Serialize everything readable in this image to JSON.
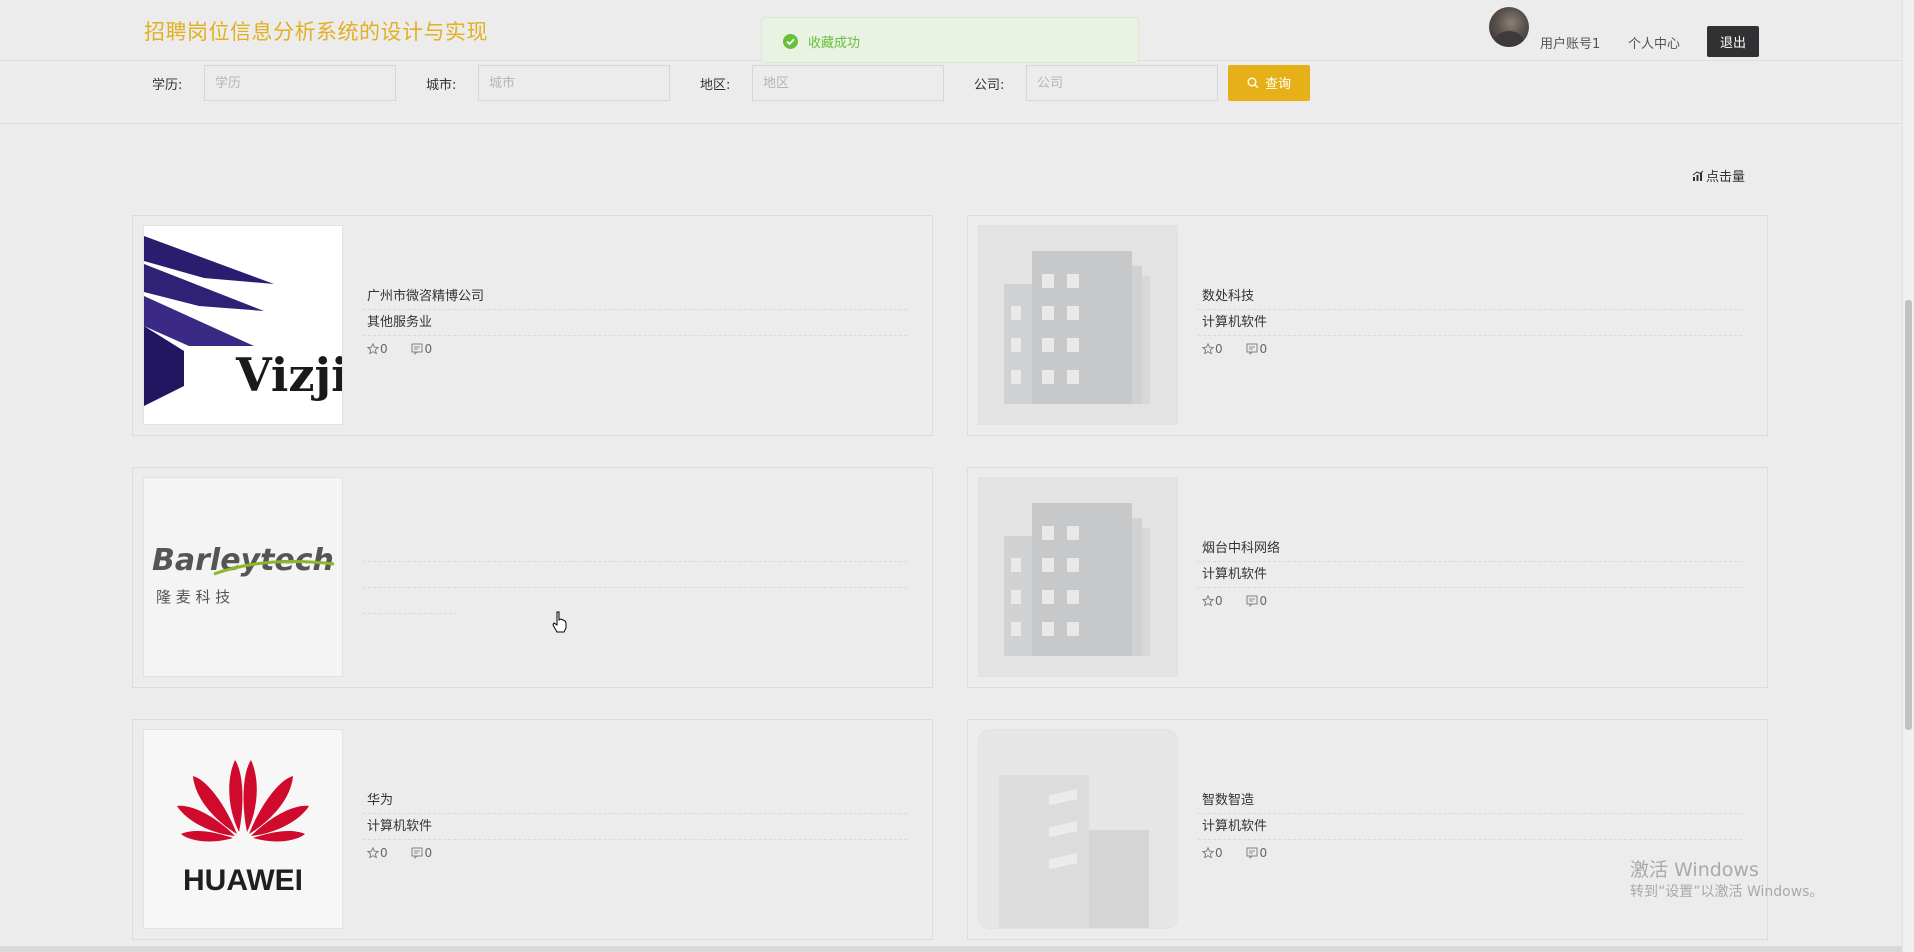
{
  "header": {
    "title": "招聘岗位信息分析系统的设计与实现",
    "user_account": "用户账号1",
    "personal_center": "个人中心",
    "logout": "退出"
  },
  "toast": {
    "message": "收藏成功",
    "icon": "check-circle-icon",
    "color": "#67c23a"
  },
  "filters": [
    {
      "label": "学历:",
      "placeholder": "学历",
      "value": ""
    },
    {
      "label": "城市:",
      "placeholder": "城市",
      "value": ""
    },
    {
      "label": "地区:",
      "placeholder": "地区",
      "value": ""
    },
    {
      "label": "公司:",
      "placeholder": "公司",
      "value": ""
    }
  ],
  "query_button": {
    "label": "查询",
    "color": "#e6b018"
  },
  "sort_link": "点击量",
  "companies": [
    {
      "name": "广州市微咨精博公司",
      "industry": "其他服务业",
      "favorites": "0",
      "comments": "0",
      "logo": "vizji-logo",
      "logo_text": "Vizji"
    },
    {
      "name": "数处科技",
      "industry": "计算机软件",
      "favorites": "0",
      "comments": "0",
      "logo": "building-placeholder"
    },
    {
      "name": "",
      "industry": "",
      "favorites": "",
      "comments": "",
      "logo": "barleytech-logo",
      "logo_text": "Barleytech",
      "logo_subtext": "隆 麦 科 技"
    },
    {
      "name": "烟台中科网络",
      "industry": "计算机软件",
      "favorites": "0",
      "comments": "0",
      "logo": "building-placeholder"
    },
    {
      "name": "华为",
      "industry": "计算机软件",
      "favorites": "0",
      "comments": "0",
      "logo": "huawei-logo",
      "logo_text": "HUAWEI"
    },
    {
      "name": "智数智造",
      "industry": "计算机软件",
      "favorites": "0",
      "comments": "0",
      "logo": "building-placeholder-faded"
    }
  ],
  "watermark": {
    "line1": "激活 Windows",
    "line2": "转到“设置”以激活 Windows。"
  }
}
